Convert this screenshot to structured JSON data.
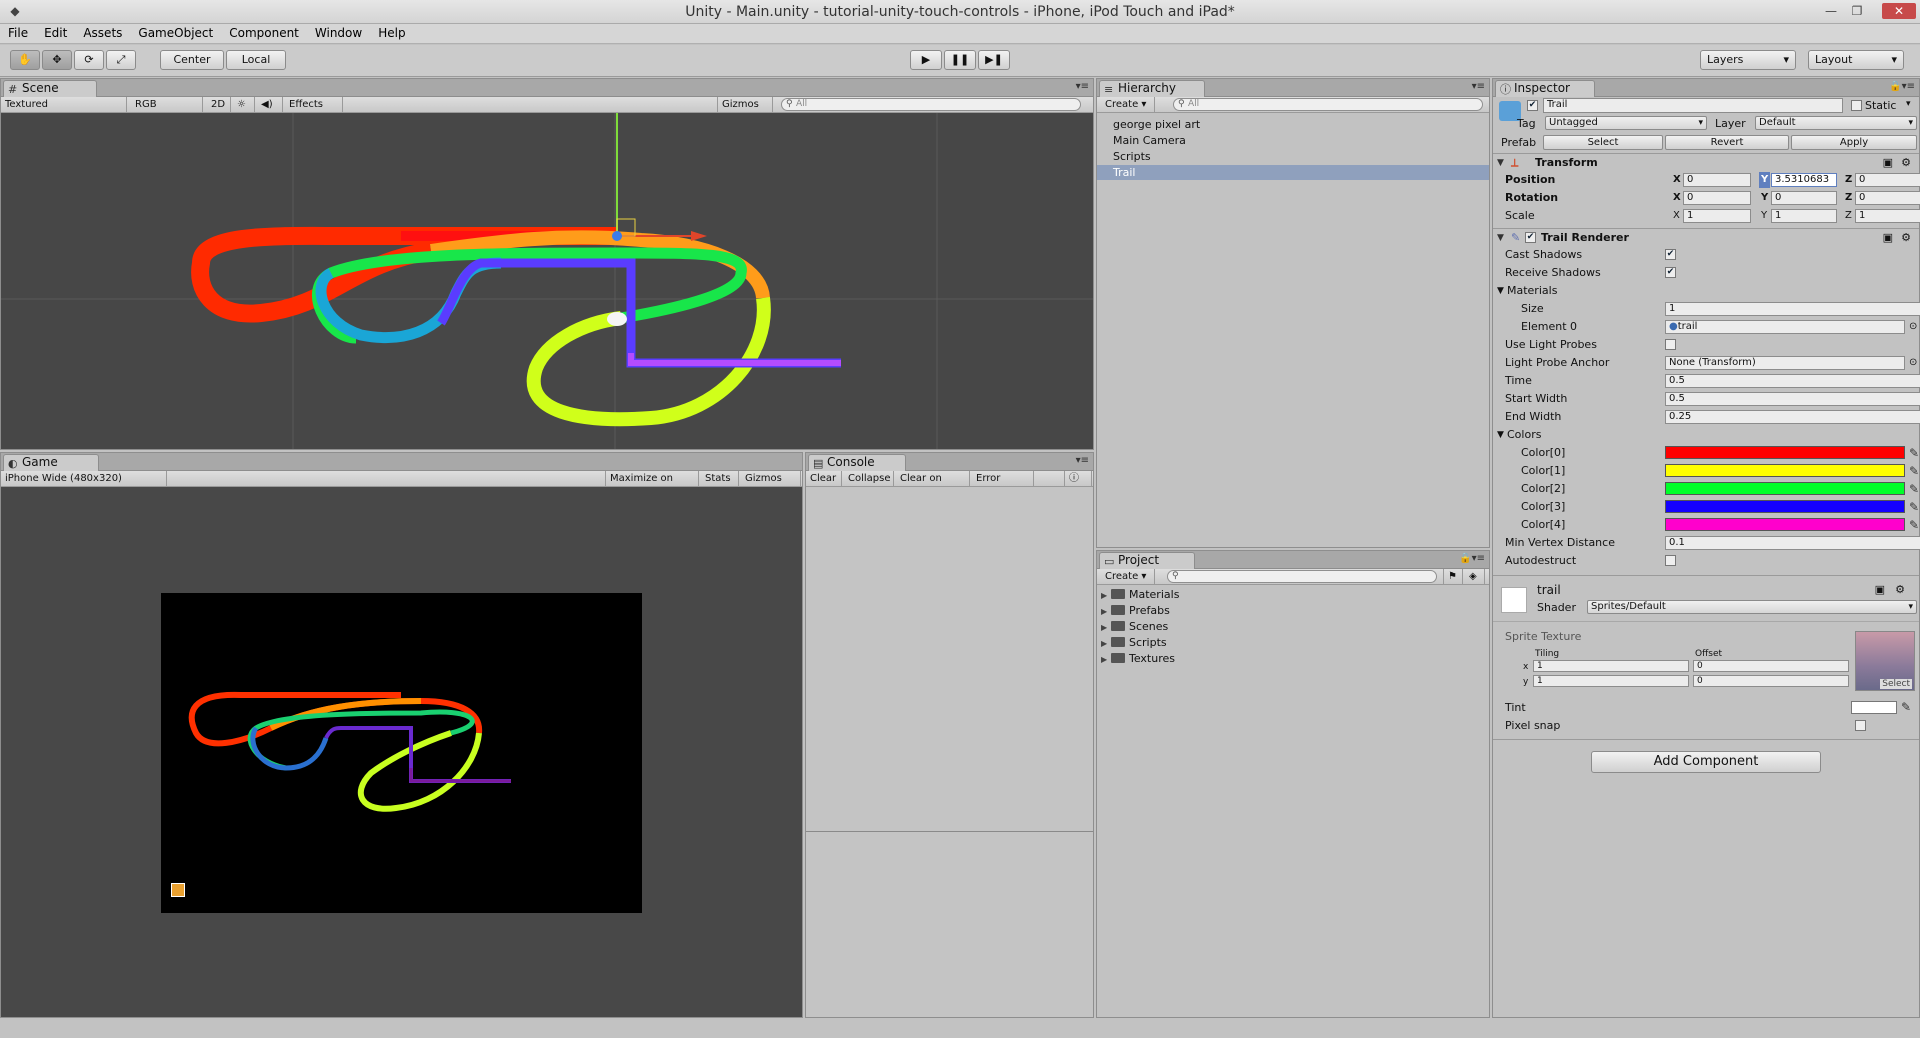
{
  "window": {
    "title": "Unity - Main.unity - tutorial-unity-touch-controls - iPhone, iPod Touch and iPad*"
  },
  "menu": [
    "File",
    "Edit",
    "Assets",
    "GameObject",
    "Component",
    "Window",
    "Help"
  ],
  "toolbar": {
    "center_label": "Center",
    "local_label": "Local",
    "layers_label": "Layers",
    "layout_label": "Layout"
  },
  "scene": {
    "tab": "Scene",
    "render_mode": "Textured",
    "color_mode": "RGB",
    "mode_2d": "2D",
    "effects": "Effects",
    "gizmos": "Gizmos",
    "search_placeholder": "All"
  },
  "game": {
    "tab": "Game",
    "resolution": "iPhone Wide (480x320)",
    "maximize": "Maximize on Play",
    "stats": "Stats",
    "gizmos": "Gizmos"
  },
  "console": {
    "tab": "Console",
    "clear": "Clear",
    "collapse": "Collapse",
    "clear_on_play": "Clear on Play",
    "error_pause": "Error Pause",
    "count": "0"
  },
  "hierarchy": {
    "tab": "Hierarchy",
    "create": "Create",
    "search_placeholder": "All",
    "items": [
      "george pixel art",
      "Main Camera",
      "Scripts",
      "Trail"
    ],
    "selected_index": 3
  },
  "project": {
    "tab": "Project",
    "create": "Create",
    "folders": [
      "Materials",
      "Prefabs",
      "Scenes",
      "Scripts",
      "Textures"
    ]
  },
  "inspector": {
    "tab": "Inspector",
    "object_name": "Trail",
    "static_label": "Static",
    "tag_label": "Tag",
    "tag_value": "Untagged",
    "layer_label": "Layer",
    "layer_value": "Default",
    "prefab_label": "Prefab",
    "prefab_select": "Select",
    "prefab_revert": "Revert",
    "prefab_apply": "Apply",
    "transform": {
      "title": "Transform",
      "position_label": "Position",
      "position": {
        "x": "0",
        "y": "3.5310683",
        "z": "0"
      },
      "rotation_label": "Rotation",
      "rotation": {
        "x": "0",
        "y": "0",
        "z": "0"
      },
      "scale_label": "Scale",
      "scale": {
        "x": "1",
        "y": "1",
        "z": "1"
      }
    },
    "trail": {
      "title": "Trail Renderer",
      "cast_shadows": "Cast Shadows",
      "receive_shadows": "Receive Shadows",
      "materials": "Materials",
      "size_label": "Size",
      "size": "1",
      "element0_label": "Element 0",
      "element0": "trail",
      "use_light_probes": "Use Light Probes",
      "light_probe_anchor_label": "Light Probe Anchor",
      "light_probe_anchor": "None (Transform)",
      "time_label": "Time",
      "time": "0.5",
      "start_width_label": "Start Width",
      "start_width": "0.5",
      "end_width_label": "End Width",
      "end_width": "0.25",
      "colors_label": "Colors",
      "colors": [
        {
          "label": "Color[0]",
          "hex": "#ff0000"
        },
        {
          "label": "Color[1]",
          "hex": "#ffff00"
        },
        {
          "label": "Color[2]",
          "hex": "#00ff2a"
        },
        {
          "label": "Color[3]",
          "hex": "#1400ff"
        },
        {
          "label": "Color[4]",
          "hex": "#ff00cc"
        }
      ],
      "min_vertex_label": "Min Vertex Distance",
      "min_vertex": "0.1",
      "autodestruct": "Autodestruct"
    },
    "material": {
      "name": "trail",
      "shader_label": "Shader",
      "shader": "Sprites/Default",
      "sprite_texture": "Sprite Texture",
      "tiling": "Tiling",
      "offset": "Offset",
      "x_label": "x",
      "y_label": "y",
      "tile_x": "1",
      "tile_y": "1",
      "off_x": "0",
      "off_y": "0",
      "select": "Select",
      "tint": "Tint",
      "pixel_snap": "Pixel snap"
    },
    "add_component": "Add Component"
  }
}
